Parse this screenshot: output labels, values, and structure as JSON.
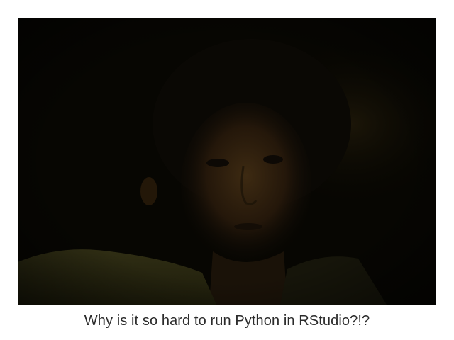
{
  "photo": {
    "subject_icon": "dark-webcam-photo",
    "palette": {
      "background": "#070602",
      "skin_shadow": "#2a1c0a",
      "skin_light": "#3a2710",
      "hair": "#0a0804",
      "shirt": "#2f2e14"
    }
  },
  "caption": {
    "text": "Why is it so hard to run Python in RStudio?!?"
  }
}
